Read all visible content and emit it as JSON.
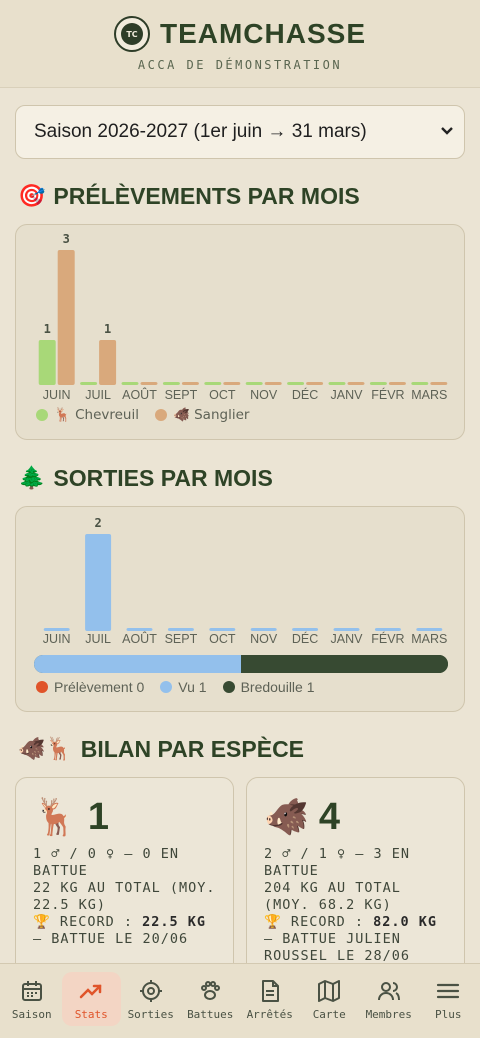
{
  "header": {
    "logo_text": "TC",
    "title": "TEAMCHASSE",
    "subtitle": "ACCA DE DÉMONSTRATION"
  },
  "season_select": {
    "value": "Saison 2026-2027 (1er juin → 31 mars)"
  },
  "sections": {
    "prelevements": {
      "icon": "🎯",
      "title": "PRÉLÈVEMENTS PAR MOIS"
    },
    "sorties": {
      "icon": "🌲",
      "title": "SORTIES PAR MOIS"
    },
    "bilan": {
      "icon": "🐗🦌",
      "title": "BILAN PAR ESPÈCE"
    }
  },
  "chart_data": [
    {
      "type": "bar",
      "categories": [
        "JUIN",
        "JUIL",
        "AOÛT",
        "SEPT",
        "OCT",
        "NOV",
        "DÉC",
        "JANV",
        "FÉVR",
        "MARS"
      ],
      "series": [
        {
          "name": "🦌 Chevreuil",
          "color": "#a8d878",
          "values": [
            1,
            0,
            0,
            0,
            0,
            0,
            0,
            0,
            0,
            0
          ]
        },
        {
          "name": "🐗 Sanglier",
          "color": "#d9a97c",
          "values": [
            3,
            1,
            0,
            0,
            0,
            0,
            0,
            0,
            0,
            0
          ]
        }
      ],
      "ylim": [
        0,
        3
      ]
    },
    {
      "type": "bar",
      "categories": [
        "JUIN",
        "JUIL",
        "AOÛT",
        "SEPT",
        "OCT",
        "NOV",
        "DÉC",
        "JANV",
        "FÉVR",
        "MARS"
      ],
      "series": [
        {
          "name": "Sorties",
          "color": "#93c0ec",
          "values": [
            0,
            2,
            0,
            0,
            0,
            0,
            0,
            0,
            0,
            0
          ]
        }
      ],
      "ylim": [
        0,
        2
      ]
    }
  ],
  "sorties_legend": [
    {
      "label": "Prélèvement 0",
      "color": "#e0542a",
      "value": 0
    },
    {
      "label": "Vu 1",
      "color": "#93c0ec",
      "value": 1
    },
    {
      "label": "Bredouille 1",
      "color": "#374a32",
      "value": 1
    }
  ],
  "species": [
    {
      "emoji": "🦌",
      "count": "1",
      "line1": "1 ♂ / 0 ♀ — 0 EN BATTUE",
      "line2": "22 KG AU TOTAL (MOY. 22.5 KG)",
      "record_prefix": "🏆 RECORD : ",
      "record_value": "22.5 KG",
      "record_suffix": " — BATTUE LE 20/06"
    },
    {
      "emoji": "🐗",
      "count": "4",
      "line1": "2 ♂ / 1 ♀ — 3 EN BATTUE",
      "line2": "204 KG AU TOTAL (MOY. 68.2 KG)",
      "record_prefix": "🏆 RECORD : ",
      "record_value": "82.0 KG",
      "record_suffix": " — BATTUE JULIEN ROUSSEL LE 28/06"
    }
  ],
  "nav": [
    {
      "label": "Saison",
      "icon": "calendar-icon",
      "active": false
    },
    {
      "label": "Stats",
      "icon": "trending-up-icon",
      "active": true
    },
    {
      "label": "Sorties",
      "icon": "crosshair-icon",
      "active": false
    },
    {
      "label": "Battues",
      "icon": "paw-icon",
      "active": false
    },
    {
      "label": "Arrêtés",
      "icon": "document-icon",
      "active": false
    },
    {
      "label": "Carte",
      "icon": "map-icon",
      "active": false
    },
    {
      "label": "Membres",
      "icon": "users-icon",
      "active": false
    },
    {
      "label": "Plus",
      "icon": "menu-icon",
      "active": false
    }
  ]
}
